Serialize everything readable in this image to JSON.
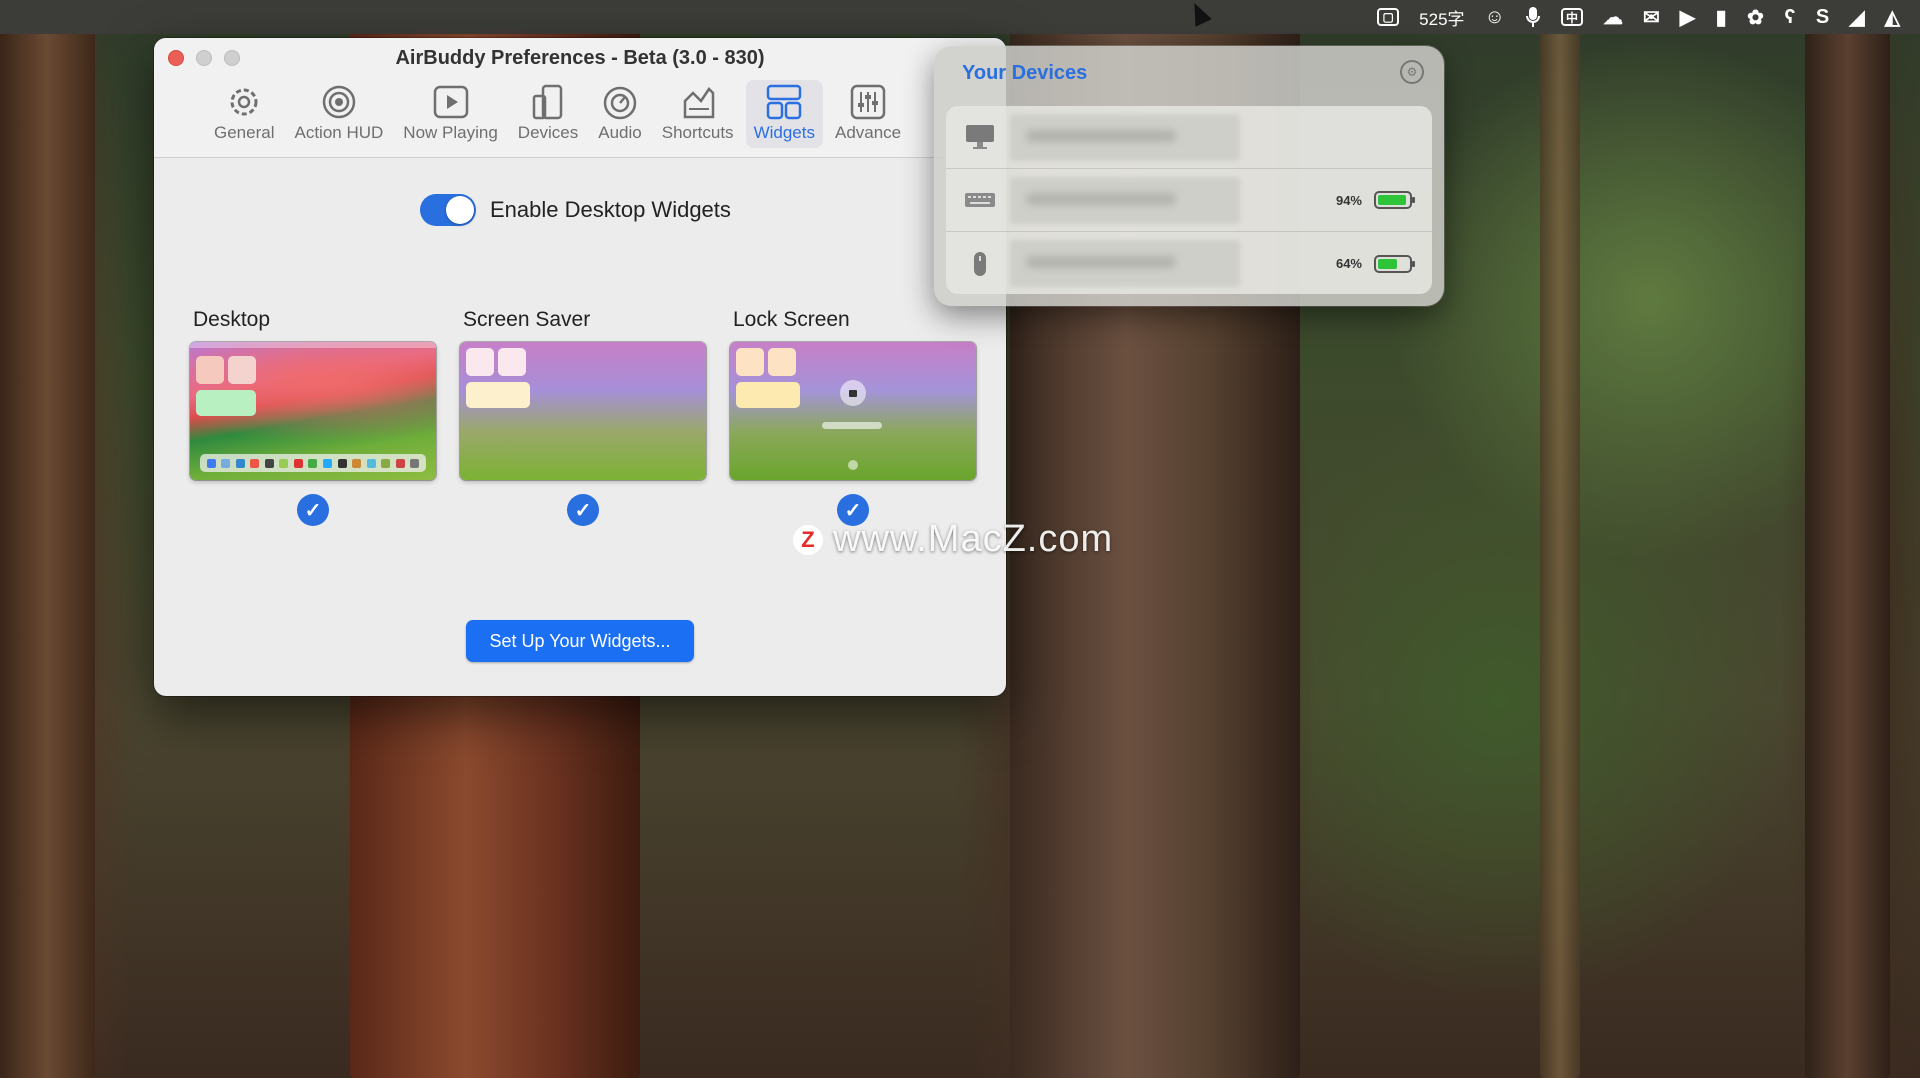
{
  "menubar": {
    "items": [
      {
        "icon": "app-icon"
      },
      {
        "text": "525字"
      },
      {
        "icon": "smiley-icon",
        "glyph": "☺"
      },
      {
        "icon": "microphone-icon",
        "glyph": "🎙"
      },
      {
        "icon": "input-method-icon",
        "glyph": "中"
      },
      {
        "icon": "cloud-icon",
        "glyph": "☁"
      },
      {
        "icon": "wechat-icon",
        "glyph": "✉"
      },
      {
        "icon": "play-icon",
        "glyph": "▶"
      },
      {
        "icon": "bookmark-icon",
        "glyph": "▮"
      },
      {
        "icon": "gear-flower-icon",
        "glyph": "✿"
      },
      {
        "icon": "bear-icon",
        "glyph": "ʕ"
      },
      {
        "icon": "s-icon",
        "glyph": "S"
      },
      {
        "icon": "chart-icon",
        "glyph": "◢"
      },
      {
        "icon": "app-icon-2",
        "glyph": "◭"
      }
    ]
  },
  "window": {
    "title": "AirBuddy Preferences - Beta (3.0 - 830)",
    "toolbar": [
      {
        "label": "General",
        "icon": "gear-icon"
      },
      {
        "label": "Action HUD",
        "icon": "hud-icon"
      },
      {
        "label": "Now Playing",
        "icon": "play-icon"
      },
      {
        "label": "Devices",
        "icon": "devices-icon"
      },
      {
        "label": "Audio",
        "icon": "audio-icon"
      },
      {
        "label": "Shortcuts",
        "icon": "shortcuts-icon"
      },
      {
        "label": "Widgets",
        "icon": "widgets-icon",
        "active": true
      },
      {
        "label": "Advance",
        "icon": "sliders-icon"
      }
    ],
    "toggle_label": "Enable Desktop Widgets",
    "toggle_on": true,
    "options": [
      {
        "name": "Desktop",
        "checked": true
      },
      {
        "name": "Screen Saver",
        "checked": true
      },
      {
        "name": "Lock Screen",
        "checked": true
      }
    ],
    "check_glyph": "✓",
    "setup_button": "Set Up Your Widgets..."
  },
  "popover": {
    "title": "Your Devices",
    "devices": [
      {
        "icon": "imac-icon",
        "percent": null,
        "level": null
      },
      {
        "icon": "keyboard-icon",
        "percent": "94%",
        "level": 0.94
      },
      {
        "icon": "mouse-icon",
        "percent": "64%",
        "level": 0.64
      }
    ]
  },
  "watermark": {
    "logo": "Z",
    "text": "www.MacZ.com"
  },
  "colors": {
    "accent": "#2a6fe0",
    "button": "#1a6ff2",
    "battery": "#2dc43a"
  }
}
